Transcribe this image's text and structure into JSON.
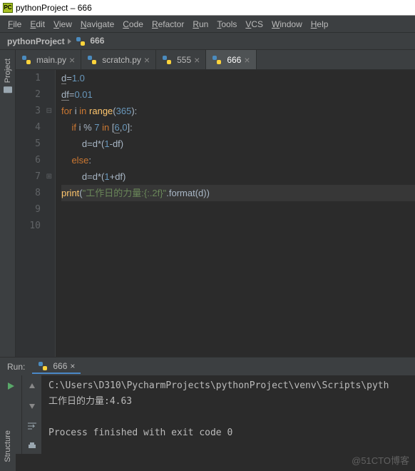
{
  "window": {
    "title": "pythonProject – 666"
  },
  "menu": [
    "File",
    "Edit",
    "View",
    "Navigate",
    "Code",
    "Refactor",
    "Run",
    "Tools",
    "VCS",
    "Window",
    "Help"
  ],
  "breadcrumb": {
    "project": "pythonProject",
    "file": "666"
  },
  "left_rail": {
    "project": "Project"
  },
  "tabs": [
    {
      "label": "main.py",
      "active": false
    },
    {
      "label": "scratch.py",
      "active": false
    },
    {
      "label": "555",
      "active": false
    },
    {
      "label": "666",
      "active": true
    }
  ],
  "code": {
    "lines": [
      {
        "n": 1,
        "segs": [
          [
            "id",
            "d"
          ],
          [
            "op",
            "="
          ],
          [
            "num",
            "1.0"
          ]
        ]
      },
      {
        "n": 2,
        "segs": [
          [
            "id",
            "df"
          ],
          [
            "op",
            "="
          ],
          [
            "num",
            "0.01"
          ]
        ]
      },
      {
        "n": 3,
        "fold": "down",
        "segs": [
          [
            "kw",
            "for "
          ],
          [
            "id",
            "i "
          ],
          [
            "kw",
            "in "
          ],
          [
            "fn",
            "range"
          ],
          [
            "op",
            "("
          ],
          [
            "num",
            "365"
          ],
          [
            "op",
            "):"
          ]
        ]
      },
      {
        "n": 4,
        "indent": 1,
        "segs": [
          [
            "kw",
            "if "
          ],
          [
            "id",
            "i "
          ],
          [
            "op",
            "% "
          ],
          [
            "num",
            "7 "
          ],
          [
            "kw",
            "in "
          ],
          [
            "op",
            "["
          ],
          [
            "num",
            "6"
          ],
          [
            "op",
            ","
          ],
          [
            "num",
            "0"
          ],
          [
            "op",
            "]:"
          ]
        ]
      },
      {
        "n": 5,
        "indent": 2,
        "segs": [
          [
            "id",
            "d"
          ],
          [
            "op",
            "="
          ],
          [
            "id",
            "d"
          ],
          [
            "op",
            "*("
          ],
          [
            "num",
            "1"
          ],
          [
            "op",
            "-"
          ],
          [
            "id",
            "df"
          ],
          [
            "op",
            ")"
          ]
        ]
      },
      {
        "n": 6,
        "indent": 1,
        "segs": [
          [
            "kw",
            "else"
          ],
          [
            "op",
            ":"
          ]
        ]
      },
      {
        "n": 7,
        "fold": "up",
        "indent": 2,
        "segs": [
          [
            "id",
            "d"
          ],
          [
            "op",
            "="
          ],
          [
            "id",
            "d"
          ],
          [
            "op",
            "*("
          ],
          [
            "num",
            "1"
          ],
          [
            "op",
            "+"
          ],
          [
            "id",
            "df"
          ],
          [
            "op",
            ")"
          ]
        ]
      },
      {
        "n": 8,
        "hl": true,
        "segs": [
          [
            "fn",
            "print"
          ],
          [
            "op",
            "("
          ],
          [
            "str",
            "\"工作日的力量:{:.2f}\""
          ],
          [
            "op",
            "."
          ],
          [
            "id",
            "format"
          ],
          [
            "op",
            "("
          ],
          [
            "id",
            "d"
          ],
          [
            "op",
            "))"
          ]
        ]
      },
      {
        "n": 9,
        "segs": []
      },
      {
        "n": 10,
        "segs": []
      }
    ]
  },
  "run": {
    "label": "Run:",
    "tab": "666",
    "output": [
      "C:\\Users\\D310\\PycharmProjects\\pythonProject\\venv\\Scripts\\pyth",
      "工作日的力量:4.63",
      "",
      "Process finished with exit code 0"
    ]
  },
  "left_bot": {
    "structure": "Structure"
  },
  "watermark": "@51CTO博客"
}
